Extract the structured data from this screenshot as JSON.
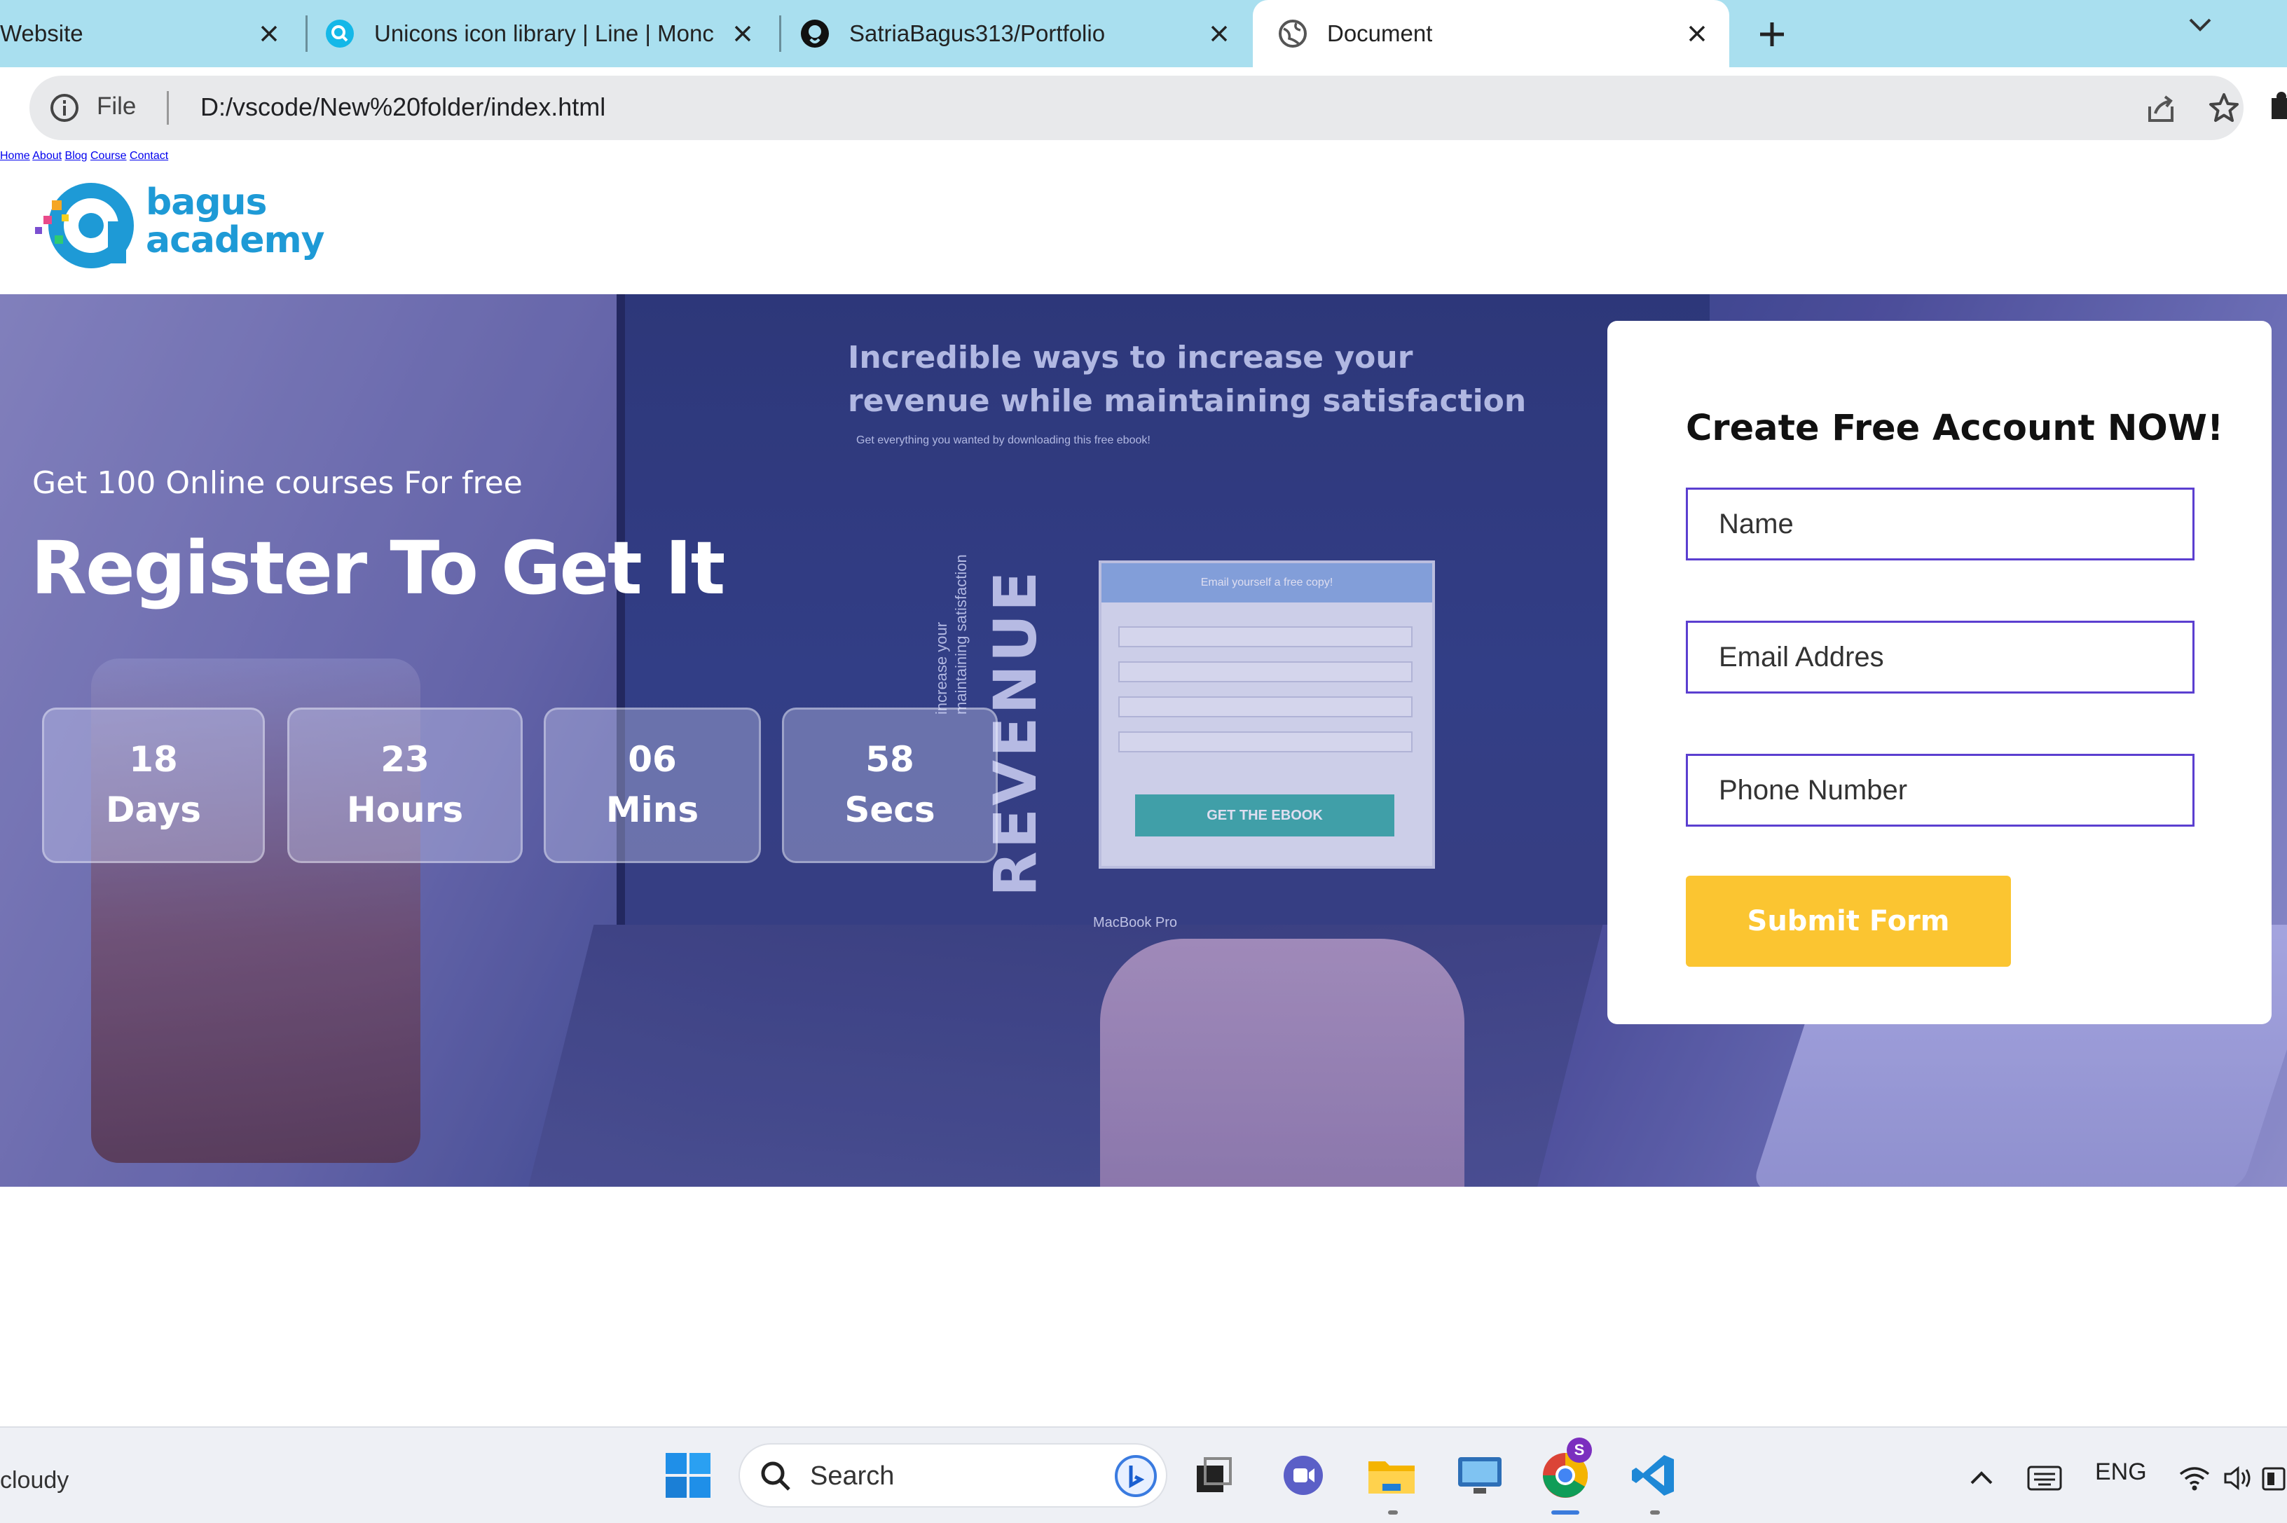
{
  "browser": {
    "tabs": [
      {
        "title": "Website",
        "active": false
      },
      {
        "title": "Unicons icon library | Line | Monc",
        "active": false
      },
      {
        "title": "SatriaBagus313/Portfolio",
        "active": false
      },
      {
        "title": "Document",
        "active": true
      }
    ],
    "address": {
      "scheme": "File",
      "url": "D:/vscode/New%20folder/index.html"
    }
  },
  "site": {
    "logo": {
      "line1": "bagus",
      "line2": "academy"
    },
    "nav": [
      "Home",
      "About",
      "Blog",
      "Course",
      "Contact"
    ],
    "hero": {
      "eyebrow": "Get 100 Online courses For free",
      "title": "Register To Get It",
      "countdown": [
        {
          "value": "18",
          "unit": "Days"
        },
        {
          "value": "23",
          "unit": "Hours"
        },
        {
          "value": "06",
          "unit": "Mins"
        },
        {
          "value": "58",
          "unit": "Secs"
        }
      ],
      "background_screen": {
        "headline_1": "Incredible ways to increase your",
        "headline_2": "revenue while maintaining satisfaction",
        "subline": "Get everything you wanted by downloading this free ebook!",
        "side_word": "REVENUE",
        "side_small_1": "increase your",
        "side_small_2": "maintaining satisfaction",
        "ebook_bar": "Email yourself a free copy!",
        "ebook_cta": "GET THE EBOOK",
        "laptop_label": "MacBook Pro"
      }
    },
    "form": {
      "heading": "Create Free Account NOW!",
      "fields": [
        {
          "placeholder": "Name"
        },
        {
          "placeholder": "Email Addres"
        },
        {
          "placeholder": "Phone Number"
        }
      ],
      "submit": "Submit Form"
    }
  },
  "taskbar": {
    "weather": "cloudy",
    "search_label": "Search",
    "language": "ENG",
    "chrome_badge": "S"
  },
  "colors": {
    "tabbar": "#a9dfef",
    "nav_text": "#2b2a6e",
    "logo_blue": "#1e9ad6",
    "input_border": "#5b3fd0",
    "submit_bg": "#fbc531"
  }
}
